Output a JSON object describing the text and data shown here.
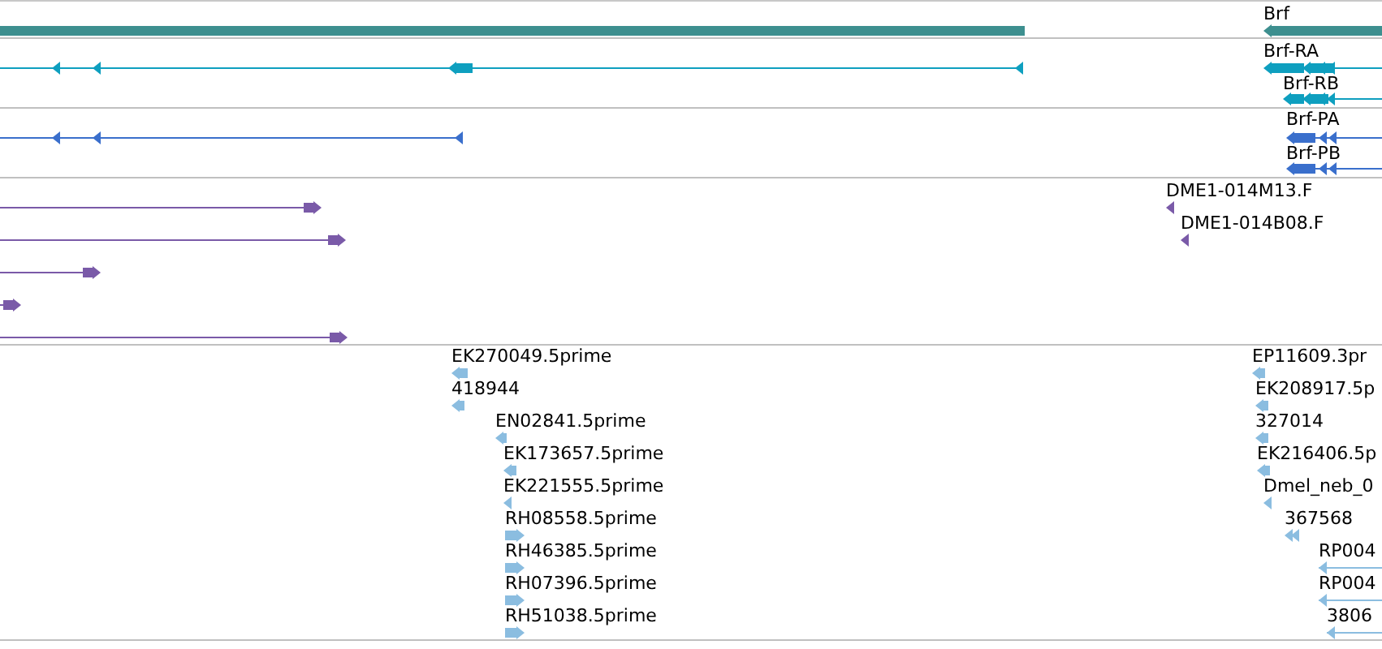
{
  "tracks": [
    {
      "kind": "gene",
      "features": [
        {
          "kind": "partial"
        },
        {
          "kind": "full",
          "reverse": true,
          "label": "Brf"
        }
      ]
    },
    {
      "kind": "transcript",
      "features": [
        {
          "kind": "full",
          "reverse": true
        },
        {
          "kind": "full",
          "reverse": true,
          "label": "Brf-RA"
        },
        {
          "kind": "full",
          "reverse": true,
          "label": "Brf-RB"
        }
      ]
    },
    {
      "kind": "protein",
      "features": [
        {
          "kind": "full",
          "reverse": true
        },
        {
          "kind": "full",
          "reverse": true,
          "label": "Brf-PA"
        },
        {
          "kind": "full",
          "reverse": true,
          "label": "Brf-PB"
        }
      ]
    },
    {
      "kind": "clone",
      "features": [
        {
          "kind": "full",
          "reverse": false
        },
        {
          "kind": "full",
          "reverse": false
        },
        {
          "kind": "full",
          "reverse": false
        },
        {
          "kind": "full",
          "reverse": false
        },
        {
          "kind": "full",
          "reverse": false
        },
        {
          "kind": "full",
          "reverse": true,
          "label": "DME1-014M13.F"
        },
        {
          "kind": "full",
          "reverse": true,
          "label": "DME1-014B08.F"
        }
      ]
    },
    {
      "kind": "est",
      "features": [
        {
          "kind": "full",
          "reverse": true,
          "label": "EK270049.5prime"
        },
        {
          "kind": "full",
          "reverse": true,
          "label": "418944"
        },
        {
          "kind": "full",
          "reverse": true,
          "label": "EN02841.5prime"
        },
        {
          "kind": "full",
          "reverse": true,
          "label": "EK173657.5prime"
        },
        {
          "kind": "full",
          "reverse": true,
          "label": "EK221555.5prime"
        },
        {
          "kind": "full",
          "reverse": false,
          "label": "RH08558.5prime"
        },
        {
          "kind": "full",
          "reverse": false,
          "label": "RH46385.5prime"
        },
        {
          "kind": "full",
          "reverse": false,
          "label": "RH07396.5prime"
        },
        {
          "kind": "full",
          "reverse": false,
          "label": "RH51038.5prime"
        },
        {
          "kind": "full",
          "reverse": true,
          "label": "EP11609.3pr"
        },
        {
          "kind": "full",
          "reverse": true,
          "label": "EK208917.5p"
        },
        {
          "kind": "full",
          "reverse": true,
          "label": "327014"
        },
        {
          "kind": "full",
          "reverse": true,
          "label": "EK216406.5p"
        },
        {
          "kind": "full",
          "reverse": true,
          "label": "Dmel_neb_0"
        },
        {
          "kind": "full",
          "reverse": true,
          "label": "367568"
        },
        {
          "kind": "full",
          "reverse": true,
          "label": "RP004"
        },
        {
          "kind": "full",
          "reverse": true,
          "label": "RP004"
        },
        {
          "kind": "full",
          "reverse": true,
          "label": "3806"
        }
      ]
    }
  ]
}
